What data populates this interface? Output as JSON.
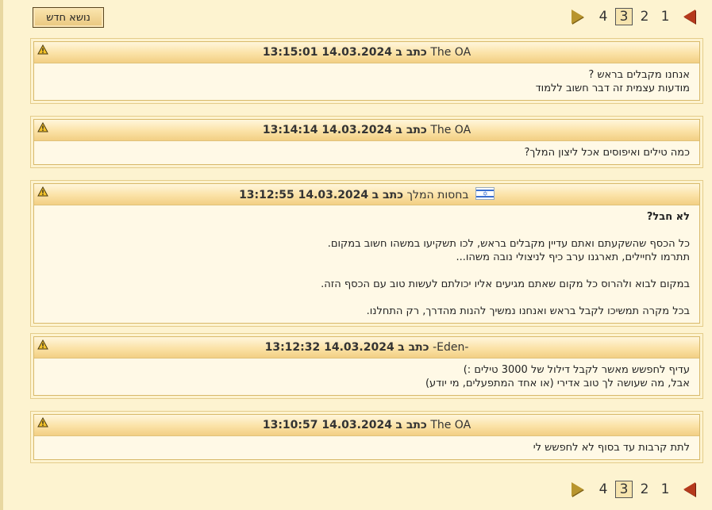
{
  "toolbar": {
    "new_topic_label": "נושא חדש"
  },
  "pagination": {
    "pages": [
      "1",
      "2",
      "3",
      "4"
    ],
    "current": "3"
  },
  "posts": [
    {
      "author": "The OA",
      "wrote": "כתב ב",
      "date": "14.03.2024 13:15:01",
      "lines": [
        "אנחנו מקבלים בראש ?",
        "מודעות עצמית זה דבר חשוב ללמוד"
      ]
    },
    {
      "author": "The OA",
      "wrote": "כתב ב",
      "date": "14.03.2024 13:14:14",
      "lines": [
        "כמה טילים ואיפוסים אכל ליצון המלך?"
      ]
    },
    {
      "author": "בחסות המלך",
      "wrote": "כתב ב",
      "date": "14.03.2024 13:12:55",
      "flag": "israel-flag-icon",
      "lines": [
        "לא חבל?",
        "",
        "כל הכסף שהשקעתם ואתם עדיין מקבלים בראש, לכו תשקיעו במשהו חשוב במקום.",
        "תתרמו לחיילים, תארגנו ערב כיף לניצולי נובה משהו...",
        "",
        "במקום לבוא ולהרוס כל מקום שאתם מגיעים אליו יכולתם לעשות טוב עם הכסף הזה.",
        "",
        "בכל מקרה תמשיכו לקבל בראש ואנחנו נמשיך להנות מהדרך, רק התחלנו."
      ]
    },
    {
      "author": "-Eden-",
      "wrote": "כתב ב",
      "date": "14.03.2024 13:12:32",
      "lines": [
        "עדיף לחפשש מאשר לקבל דילול של 3000 טילים :)",
        "אבל, מה שעושה לך טוב אדירי (או אחד המתפעלים, מי יודע)"
      ]
    },
    {
      "author": "The OA",
      "wrote": "כתב ב",
      "date": "14.03.2024 13:10:57",
      "lines": [
        "לתת קרבות עד בסוף לא לחפשש לי"
      ]
    }
  ],
  "colors": {
    "background": "#fdf3d0",
    "header_gradient_top": "#fff6dc",
    "header_gradient_bottom": "#f2cf84",
    "next_arrow": "#b8952e",
    "prev_arrow": "#b5391c"
  }
}
